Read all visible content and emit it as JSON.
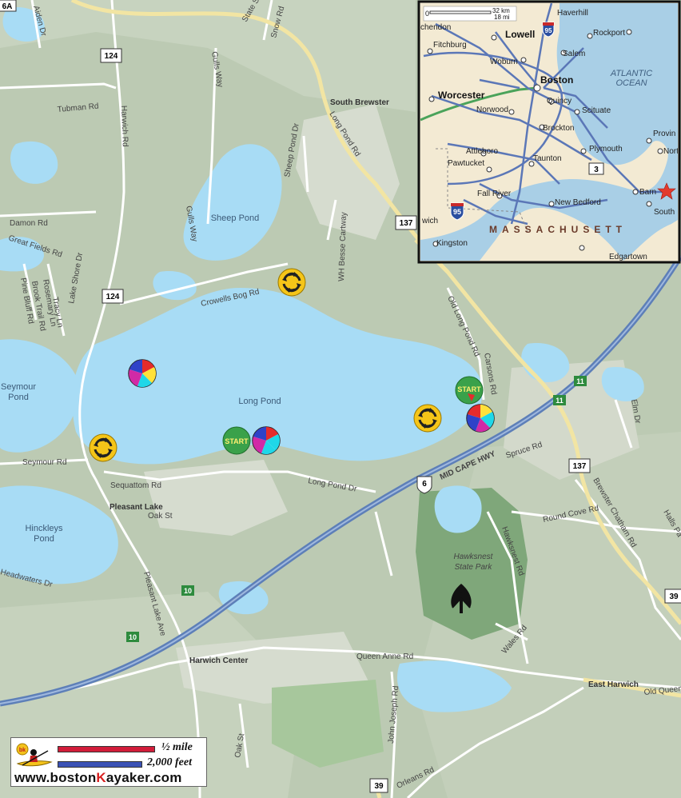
{
  "map": {
    "water_labels": {
      "seymour_pond": [
        "Seymour",
        "Pond"
      ],
      "sheep_pond": "Sheep Pond",
      "long_pond": "Long Pond",
      "hinckleys_pond": [
        "Hinckleys",
        "Pond"
      ]
    },
    "town_labels": {
      "south_brewster": "South Brewster",
      "pleasant_lake": "Pleasant Lake",
      "harwich_center": "Harwich Center",
      "east_harwich": "East Harwich",
      "hawksnest": [
        "Hawksnest",
        "State Park"
      ]
    },
    "road_labels": {
      "harwich_rd": "Harwich Rd",
      "long_pond_rd": "Long Pond Rd",
      "state_st": "State St",
      "snow_rd": "Snow Rd",
      "aiden_dr": "Aiden Dr",
      "tubman_rd": "Tubman Rd",
      "gulls_way_top": "Gulls Way",
      "gulls_way": "Gulls Way",
      "sheep_pond_dr": "Sheep Pond Dr",
      "wh_besse_cartway": "WH Besse Cartway",
      "crowells_bog_rd": "Crowells Bog Rd",
      "damon_rd": "Damon Rd",
      "great_fields_rd": "Great Fields Rd",
      "pine_bluff_rd": "Pine Bluff Rd",
      "brook_trail_rd": "Brook Trail Rd",
      "rosemary_ln": "Rosemary Ln",
      "tracy_ln": "Tracy Ln",
      "lake_shore_dr": "Lake Shore Dr",
      "old_long_pond_rd": "Old Long Pond Rd",
      "carsons_rd": "Carsons Rd",
      "seymour_rd": "Seymour Rd",
      "sequattom_rd": "Sequattom Rd",
      "oak_st": "Oak St",
      "long_pond_dr": "Long Pond Dr",
      "mid_cape_hwy": "MID CAPE HWY",
      "spruce_rd": "Spruce Rd",
      "round_cove_rd": "Round Cove Rd",
      "brewster_chatham_rd": "Brewster Chatham Rd",
      "elm_dr": "Elm Dr",
      "halls_path": "Halls Pa",
      "hawksnest_rd": "Hawksnest Rd",
      "headwaters_dr": "Headwaters Dr",
      "pleasant_lake_ave": "Pleasant Lake Ave",
      "queen_anne_rd": "Queen Anne Rd",
      "wales_rd": "Wales Rd",
      "old_queen": "Old Queen",
      "john_joseph_rd": "John Joseph Rd",
      "orleans_rd": "Orleans Rd",
      "oak_st_south": "Oak St"
    },
    "shields": {
      "s6a": "6A",
      "s124_top": "124",
      "s124_mid": "124",
      "s137_top": "137",
      "s137_bottom": "137",
      "s6": "6",
      "s39_right": "39",
      "s39_bottom": "39"
    },
    "exits": {
      "e11_a": "11",
      "e11_b": "11",
      "e10_a": "10",
      "e10_b": "10"
    },
    "markers": {
      "start_label": "START"
    }
  },
  "inset": {
    "scale_km": "32 km",
    "scale_mi": "18 mi",
    "scale_zero": "0",
    "ocean": [
      "ATLANTIC",
      "OCEAN"
    ],
    "state": "MASSACHUSETT",
    "route_95_top": "95",
    "route_95_bottom": "95",
    "route_3": "3",
    "places": {
      "haverhill": "Haverhill",
      "lowell": "Lowell",
      "chendon": "chendon",
      "rockport": "Rockport",
      "fitchburg": "Fitchburg",
      "woburn": "Woburn",
      "salem": "Salem",
      "boston": "Boston",
      "worcester": "Worcester",
      "quincy": "Quincy",
      "norwood": "Norwood",
      "scituate": "Scituate",
      "brockton": "Brockton",
      "plymouth": "Plymouth",
      "attleboro": "Attleboro",
      "pawtucket": "Pawtucket",
      "taunton": "Taunton",
      "fall_river": "Fall River",
      "new_bedford": "New Bedford",
      "barnstable": "Barn",
      "south": "South",
      "kingston": "Kingston",
      "edgartown": "Edgartown",
      "provincetown": "Provin",
      "north": "Nort",
      "wich": "wich"
    }
  },
  "legend": {
    "mile": "½ mile",
    "feet": "2,000 feet",
    "site_prefix": "www.boston",
    "site_k": "K",
    "site_suffix": "ayaker.com",
    "logo_text": "bk"
  }
}
